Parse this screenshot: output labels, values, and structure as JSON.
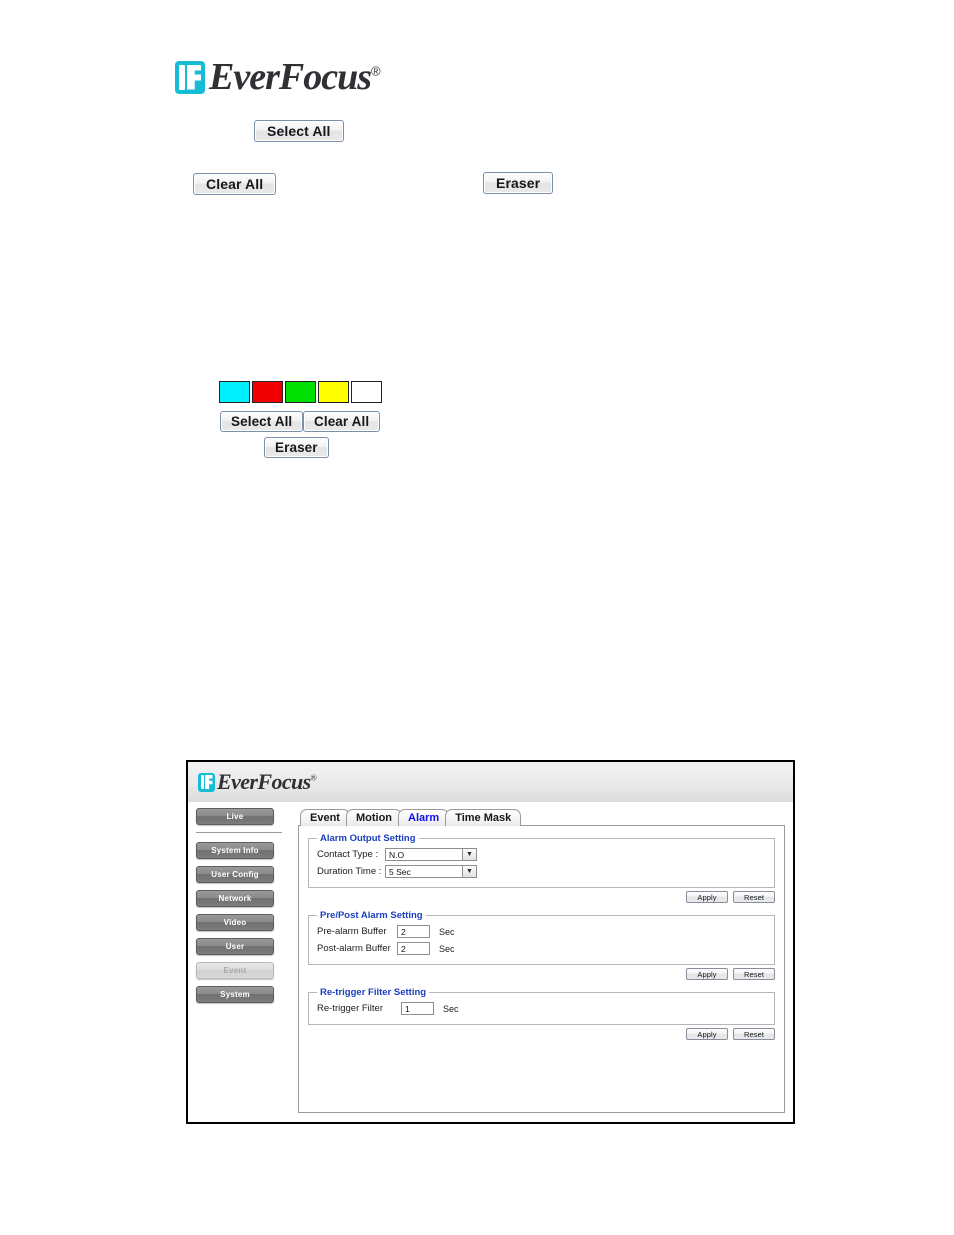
{
  "page_logo": {
    "word": "EverFocus",
    "registered": "®"
  },
  "top_buttons": {
    "select_all": "Select All",
    "clear_all": "Clear All",
    "eraser": "Eraser"
  },
  "palette": {
    "swatches": [
      {
        "name": "cyan",
        "color": "#00f0ff"
      },
      {
        "name": "red",
        "color": "#f00000"
      },
      {
        "name": "green",
        "color": "#00e000"
      },
      {
        "name": "yellow",
        "color": "#ffff00"
      },
      {
        "name": "white",
        "color": "#ffffff"
      }
    ],
    "select_all": "Select All",
    "clear_all": "Clear All",
    "eraser": "Eraser"
  },
  "app": {
    "header": {
      "word": "EverFocus",
      "registered": "®"
    },
    "sidebar": {
      "live": "Live",
      "items": [
        {
          "label": "System Info",
          "active": false
        },
        {
          "label": "User Config",
          "active": false
        },
        {
          "label": "Network",
          "active": false
        },
        {
          "label": "Video",
          "active": false
        },
        {
          "label": "User",
          "active": false
        },
        {
          "label": "Event",
          "active": true
        },
        {
          "label": "System",
          "active": false
        }
      ]
    },
    "tabs": [
      {
        "label": "Event",
        "active": false
      },
      {
        "label": "Motion",
        "active": false
      },
      {
        "label": "Alarm",
        "active": true
      },
      {
        "label": "Time Mask",
        "active": false
      }
    ],
    "accent_color": "#1111ee",
    "groups": {
      "alarm_output": {
        "legend": "Alarm Output Setting",
        "contact_type_label": "Contact Type :",
        "contact_type_value": "N.O",
        "duration_time_label": "Duration Time :",
        "duration_time_value": "5 Sec",
        "apply": "Apply",
        "reset": "Reset"
      },
      "pre_post_alarm": {
        "legend": "Pre/Post Alarm Setting",
        "pre_label": "Pre-alarm Buffer",
        "pre_value": "2",
        "pre_unit": "Sec",
        "post_label": "Post-alarm Buffer",
        "post_value": "2",
        "post_unit": "Sec",
        "apply": "Apply",
        "reset": "Reset"
      },
      "retrigger_filter": {
        "legend": "Re-trigger Filter Setting",
        "filter_label": "Re-trigger Filter",
        "filter_value": "1",
        "filter_unit": "Sec",
        "apply": "Apply",
        "reset": "Reset"
      }
    }
  }
}
